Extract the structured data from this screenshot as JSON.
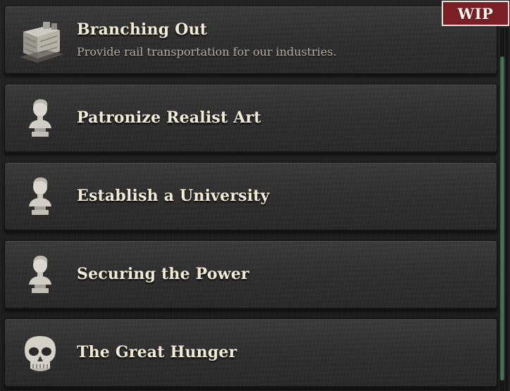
{
  "badge": {
    "label": "WIP"
  },
  "decisions": [
    {
      "title": "Branching Out",
      "description": "Provide rail transportation for our industries.",
      "icon": "rail-crate-icon"
    },
    {
      "title": "Patronize Realist Art",
      "description": "",
      "icon": "marble-bust-icon"
    },
    {
      "title": "Establish a University",
      "description": "",
      "icon": "marble-bust-icon"
    },
    {
      "title": "Securing the Power",
      "description": "",
      "icon": "marble-bust-icon"
    },
    {
      "title": "The Great Hunger",
      "description": "",
      "icon": "skull-icon"
    }
  ],
  "colors": {
    "badge_background": "#7b1f27",
    "title_text": "#f1ead6",
    "description_text": "#b8b2a4",
    "scroll_thumb": "#4b7a5d"
  }
}
